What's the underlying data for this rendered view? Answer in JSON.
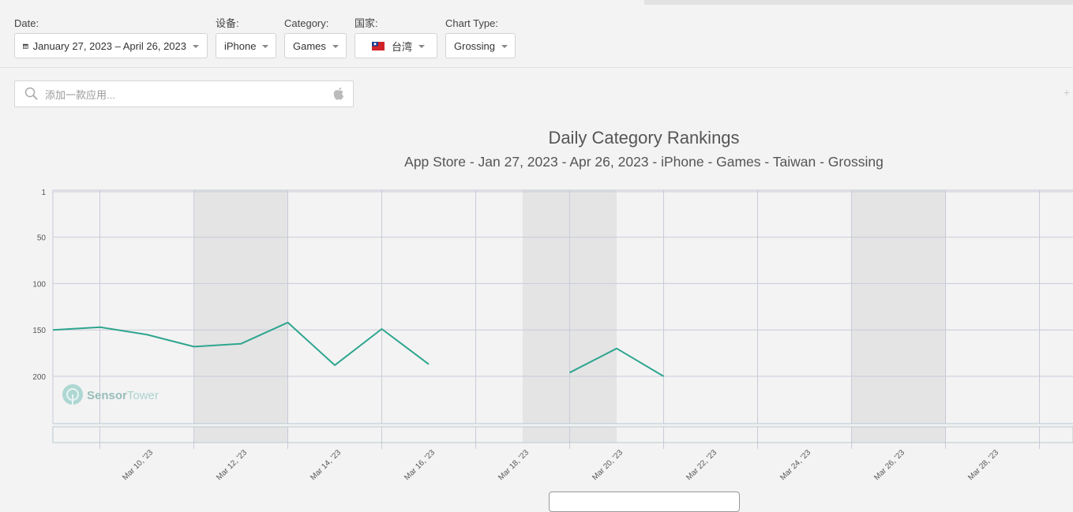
{
  "filters": {
    "date": {
      "label": "Date:",
      "value": "January 27, 2023 – April 26, 2023"
    },
    "device": {
      "label": "设备:",
      "value": "iPhone"
    },
    "category": {
      "label": "Category:",
      "value": "Games"
    },
    "country": {
      "label": "国家:",
      "value": "台湾"
    },
    "chart_type": {
      "label": "Chart Type:",
      "value": "Grossing"
    }
  },
  "search": {
    "placeholder": "添加一款应用..."
  },
  "watermark": {
    "brand": "Sensor",
    "brand_suffix": "Tower"
  },
  "colors": {
    "series": "#2ea58f",
    "weekend_band": "#e4e4e4",
    "grid": "#c8cbd8",
    "flag_red": "#d1232a",
    "flag_blue": "#1e3a8c"
  },
  "icons": [
    "calendar-icon",
    "taiwan-flag-icon",
    "search-icon",
    "apple-icon",
    "sensortower-logo-icon"
  ],
  "chart_data": {
    "type": "line",
    "title": "Daily Category Rankings",
    "subtitle": "App Store - Jan 27, 2023 - Apr 26, 2023 - iPhone - Games - Taiwan - Grossing",
    "y_axis": {
      "reversed": true,
      "ticks": [
        1,
        50,
        100,
        150,
        200
      ],
      "range": [
        1,
        250
      ]
    },
    "x_axis": {
      "start": "2023-03-08",
      "end": "2023-03-29",
      "tick_labels": [
        {
          "date": "2023-03-10",
          "label": "Mar 10, '23"
        },
        {
          "date": "2023-03-12",
          "label": "Mar 12, '23"
        },
        {
          "date": "2023-03-14",
          "label": "Mar 14, '23"
        },
        {
          "date": "2023-03-16",
          "label": "Mar 16, '23"
        },
        {
          "date": "2023-03-18",
          "label": "Mar 18, '23"
        },
        {
          "date": "2023-03-20",
          "label": "Mar 20, '23"
        },
        {
          "date": "2023-03-22",
          "label": "Mar 22, '23"
        },
        {
          "date": "2023-03-24",
          "label": "Mar 24, '23"
        },
        {
          "date": "2023-03-26",
          "label": "Mar 26, '23"
        },
        {
          "date": "2023-03-28",
          "label": "Mar 28, '23"
        }
      ]
    },
    "weekend_bands": [
      {
        "from": "2023-03-11",
        "to": "2023-03-13"
      },
      {
        "from": "2023-03-18",
        "to": "2023-03-20"
      },
      {
        "from": "2023-03-25",
        "to": "2023-03-27"
      }
    ],
    "grid": true,
    "series": [
      {
        "points": [
          {
            "date": "2023-03-08",
            "rank": 150
          },
          {
            "date": "2023-03-09",
            "rank": 147
          },
          {
            "date": "2023-03-10",
            "rank": 155
          },
          {
            "date": "2023-03-11",
            "rank": 168
          },
          {
            "date": "2023-03-12",
            "rank": 165
          },
          {
            "date": "2023-03-13",
            "rank": 142
          },
          {
            "date": "2023-03-14",
            "rank": 188
          },
          {
            "date": "2023-03-15",
            "rank": 149
          },
          {
            "date": "2023-03-16",
            "rank": 187
          },
          {
            "date": "2023-03-17",
            "rank": null
          },
          {
            "date": "2023-03-18",
            "rank": null
          },
          {
            "date": "2023-03-19",
            "rank": 196
          },
          {
            "date": "2023-03-20",
            "rank": 170
          },
          {
            "date": "2023-03-21",
            "rank": 200
          }
        ]
      }
    ]
  }
}
